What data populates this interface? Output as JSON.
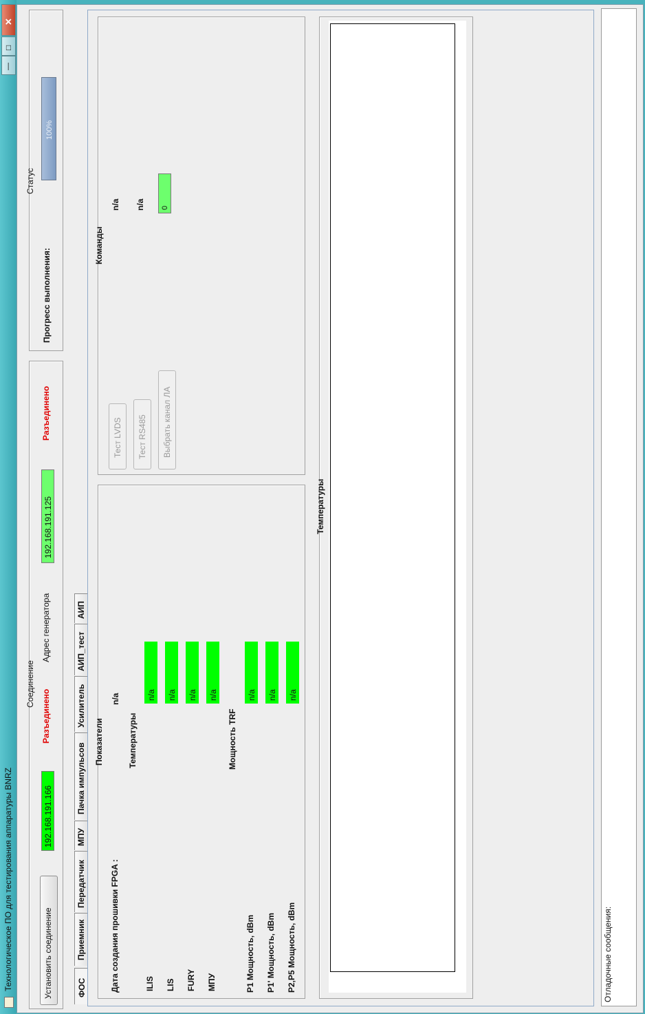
{
  "window": {
    "title": "Технологическое ПО для тестирования аппаратуры BNRZ",
    "close_glyph": "✕",
    "maximize_glyph": "□",
    "minimize_glyph": "—"
  },
  "connection": {
    "heading": "Соединение",
    "connect_button": "Установить соединение",
    "ip1": "192.168.191.166",
    "status1": "Разъединено",
    "generator_label": "Адрес генератора",
    "ip2": "192.168.191.125",
    "status2": "Разъединено"
  },
  "status": {
    "heading": "Статус",
    "progress_label": "Прогресс выполнения:",
    "progress_text": "100%",
    "progress_value": 1.0
  },
  "tabs": [
    "ФОС",
    "Приемник",
    "Передатчик",
    "МПУ",
    "Пачка импульсов",
    "Усилитель",
    "АИП_тест",
    "АИП"
  ],
  "indicators": {
    "heading": "Показатели",
    "fpga_label": "Дата создания прошивки FPGA :",
    "fpga_value": "n/a",
    "temps_heading": "Температуры",
    "temps": [
      {
        "name": "ILIS",
        "value": "n/a"
      },
      {
        "name": "LIS",
        "value": "n/a"
      },
      {
        "name": "FURY",
        "value": "n/a"
      },
      {
        "name": "МПУ",
        "value": "n/a"
      }
    ],
    "power_heading": "Мощность TRF",
    "powers": [
      {
        "name": "P1   Мощность, dBm",
        "value": "n/a"
      },
      {
        "name": "P1'   Мощность, dBm",
        "value": "n/a"
      },
      {
        "name": "P2,P5 Мощность, dBm",
        "value": "n/a"
      }
    ]
  },
  "commands": {
    "heading": "Команды",
    "test_lvds": "Тест LVDS",
    "test_rs485": "Тест RS485",
    "choose_channel": "Выбрать канал ЛА",
    "lvds_result": "n/a",
    "rs485_result": "n/a",
    "channel_value": "0"
  },
  "temperatures_chart": {
    "heading": "Температуры"
  },
  "debug": {
    "label": "Отладочные сообщения:"
  },
  "colors": {
    "green": "#00ff00",
    "light_green": "#6dff6d",
    "disconnected_red": "#e00000",
    "progress_blue": "#8aa6c8"
  }
}
